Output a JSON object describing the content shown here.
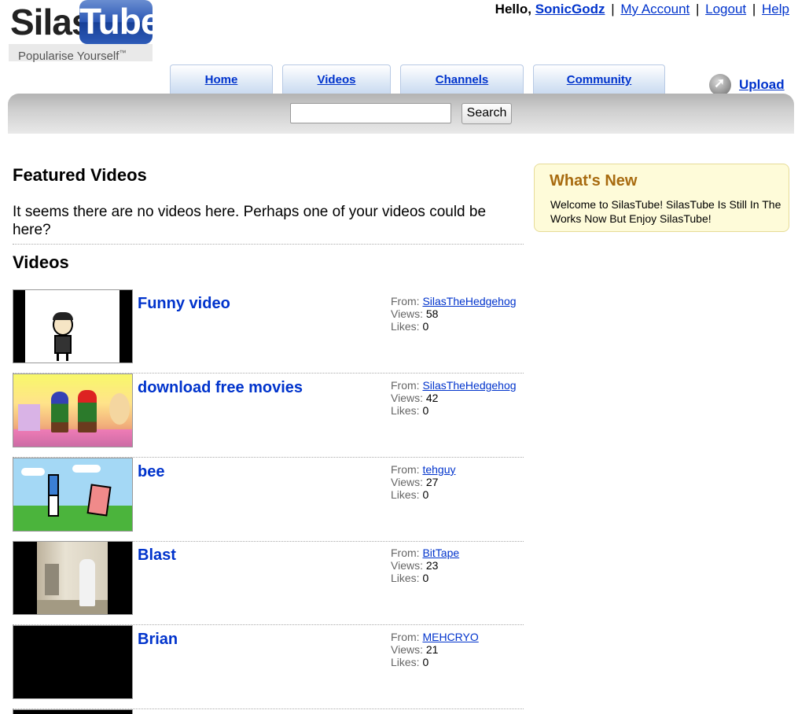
{
  "logo": {
    "word1": "Silas",
    "word2": "Tube",
    "tagline": "Popularise Yourself",
    "tm": "™"
  },
  "usernav": {
    "hello": "Hello,",
    "username": "SonicGodz",
    "sep": "|",
    "links": [
      "My Account",
      "Logout",
      "Help"
    ]
  },
  "tabs": [
    "Home",
    "Videos",
    "Channels",
    "Community"
  ],
  "upload": {
    "label": "Upload"
  },
  "search": {
    "value": "",
    "placeholder": "",
    "button": "Search"
  },
  "featured": {
    "title": "Featured Videos",
    "empty_message": "It seems there are no videos here. Perhaps one of your videos could be here?"
  },
  "videos_section": {
    "title": "Videos",
    "labels": {
      "from": "From:",
      "views": "Views:",
      "likes": "Likes:"
    },
    "items": [
      {
        "title": "Funny video",
        "from": "SilasTheHedgehog",
        "views": "58",
        "likes": "0"
      },
      {
        "title": "download free movies",
        "from": "SilasTheHedgehog",
        "views": "42",
        "likes": "0"
      },
      {
        "title": "bee",
        "from": "tehguy",
        "views": "27",
        "likes": "0"
      },
      {
        "title": "Blast",
        "from": "BitTape",
        "views": "23",
        "likes": "0"
      },
      {
        "title": "Brian",
        "from": "MEHCRYO",
        "views": "21",
        "likes": "0"
      }
    ]
  },
  "whats_new": {
    "title": "What's New",
    "text": "Welcome to SilasTube! SilasTube Is Still In The Works Now But Enjoy SilasTube!"
  },
  "colors": {
    "link": "#0033cc",
    "whats_new_title": "#a86b10",
    "whats_new_bg": "#fefbd9"
  }
}
